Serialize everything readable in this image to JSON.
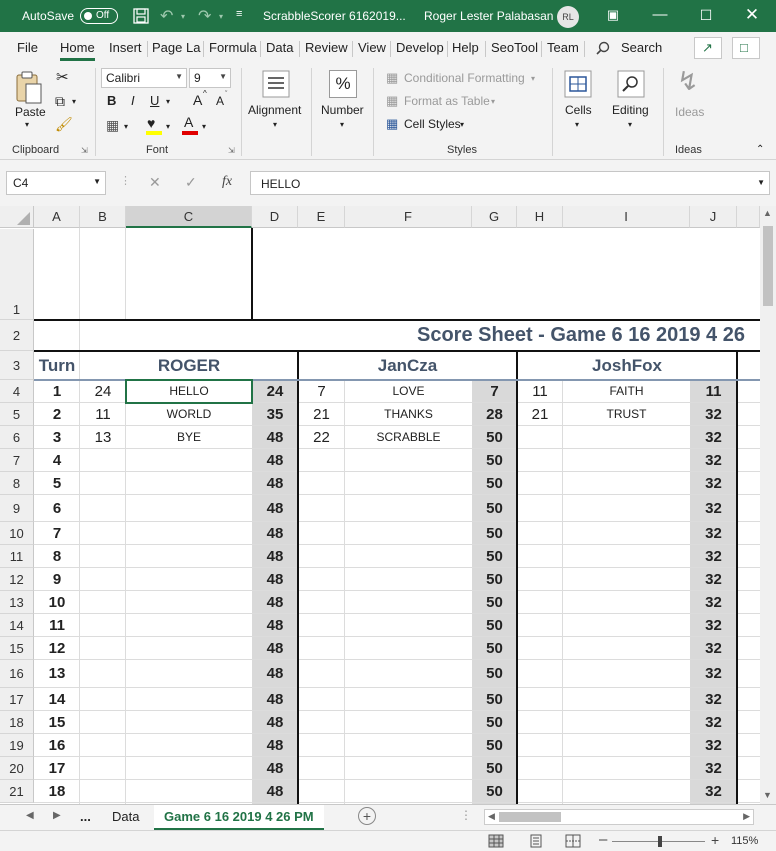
{
  "titlebar": {
    "autosave_label": "AutoSave",
    "autosave_state": "Off",
    "filename": "ScrabbleScorer 6162019...",
    "user_name": "Roger Lester Palabasan",
    "user_initials": "RL"
  },
  "menu": {
    "tabs": [
      "File",
      "Home",
      "Insert",
      "Page La",
      "Formula",
      "Data",
      "Review",
      "View",
      "Develop",
      "Help",
      "SeoTool",
      "Team"
    ],
    "search_label": "Search"
  },
  "ribbon": {
    "clipboard": {
      "paste": "Paste",
      "label": "Clipboard"
    },
    "font": {
      "name": "Calibri",
      "size": "9",
      "label": "Font",
      "bold": "B",
      "italic": "I",
      "underline": "U",
      "grow": "A",
      "shrink": "A"
    },
    "alignment": {
      "label": "Alignment"
    },
    "number": {
      "label": "Number",
      "icon_text": "%"
    },
    "styles": {
      "conditional_formatting": "Conditional Formatting",
      "format_as_table": "Format as Table",
      "cell_styles": "Cell Styles",
      "label": "Styles"
    },
    "cells": {
      "label": "Cells"
    },
    "editing": {
      "label": "Editing"
    },
    "ideas": {
      "label": "Ideas",
      "group_label": "Ideas"
    }
  },
  "formula_bar": {
    "name_box": "C4",
    "fx": "fx",
    "value": "HELLO"
  },
  "sheet": {
    "columns": [
      "A",
      "B",
      "C",
      "D",
      "E",
      "F",
      "G",
      "H",
      "I",
      "J"
    ],
    "title": "Score Sheet  - Game 6 16 2019 4 26",
    "turn_header": "Turn",
    "players": [
      "ROGER",
      "JanCza",
      "JoshFox"
    ],
    "rows": [
      {
        "row": "4",
        "turn": "1",
        "p1_pts": "24",
        "p1_word": "HELLO",
        "p1_total": "24",
        "p2_pts": "7",
        "p2_word": "LOVE",
        "p2_total": "7",
        "p3_pts": "11",
        "p3_word": "FAITH",
        "p3_total": "11"
      },
      {
        "row": "5",
        "turn": "2",
        "p1_pts": "11",
        "p1_word": "WORLD",
        "p1_total": "35",
        "p2_pts": "21",
        "p2_word": "THANKS",
        "p2_total": "28",
        "p3_pts": "21",
        "p3_word": "TRUST",
        "p3_total": "32"
      },
      {
        "row": "6",
        "turn": "3",
        "p1_pts": "13",
        "p1_word": "BYE",
        "p1_total": "48",
        "p2_pts": "22",
        "p2_word": "SCRABBLE",
        "p2_total": "50",
        "p3_pts": "",
        "p3_word": "",
        "p3_total": "32"
      },
      {
        "row": "7",
        "turn": "4",
        "p1_pts": "",
        "p1_word": "",
        "p1_total": "48",
        "p2_pts": "",
        "p2_word": "",
        "p2_total": "50",
        "p3_pts": "",
        "p3_word": "",
        "p3_total": "32"
      },
      {
        "row": "8",
        "turn": "5",
        "p1_pts": "",
        "p1_word": "",
        "p1_total": "48",
        "p2_pts": "",
        "p2_word": "",
        "p2_total": "50",
        "p3_pts": "",
        "p3_word": "",
        "p3_total": "32"
      },
      {
        "row": "9",
        "turn": "6",
        "p1_pts": "",
        "p1_word": "",
        "p1_total": "48",
        "p2_pts": "",
        "p2_word": "",
        "p2_total": "50",
        "p3_pts": "",
        "p3_word": "",
        "p3_total": "32"
      },
      {
        "row": "10",
        "turn": "7",
        "p1_pts": "",
        "p1_word": "",
        "p1_total": "48",
        "p2_pts": "",
        "p2_word": "",
        "p2_total": "50",
        "p3_pts": "",
        "p3_word": "",
        "p3_total": "32"
      },
      {
        "row": "11",
        "turn": "8",
        "p1_pts": "",
        "p1_word": "",
        "p1_total": "48",
        "p2_pts": "",
        "p2_word": "",
        "p2_total": "50",
        "p3_pts": "",
        "p3_word": "",
        "p3_total": "32"
      },
      {
        "row": "12",
        "turn": "9",
        "p1_pts": "",
        "p1_word": "",
        "p1_total": "48",
        "p2_pts": "",
        "p2_word": "",
        "p2_total": "50",
        "p3_pts": "",
        "p3_word": "",
        "p3_total": "32"
      },
      {
        "row": "13",
        "turn": "10",
        "p1_pts": "",
        "p1_word": "",
        "p1_total": "48",
        "p2_pts": "",
        "p2_word": "",
        "p2_total": "50",
        "p3_pts": "",
        "p3_word": "",
        "p3_total": "32"
      },
      {
        "row": "14",
        "turn": "11",
        "p1_pts": "",
        "p1_word": "",
        "p1_total": "48",
        "p2_pts": "",
        "p2_word": "",
        "p2_total": "50",
        "p3_pts": "",
        "p3_word": "",
        "p3_total": "32"
      },
      {
        "row": "15",
        "turn": "12",
        "p1_pts": "",
        "p1_word": "",
        "p1_total": "48",
        "p2_pts": "",
        "p2_word": "",
        "p2_total": "50",
        "p3_pts": "",
        "p3_word": "",
        "p3_total": "32"
      },
      {
        "row": "16",
        "turn": "13",
        "p1_pts": "",
        "p1_word": "",
        "p1_total": "48",
        "p2_pts": "",
        "p2_word": "",
        "p2_total": "50",
        "p3_pts": "",
        "p3_word": "",
        "p3_total": "32"
      },
      {
        "row": "17",
        "turn": "14",
        "p1_pts": "",
        "p1_word": "",
        "p1_total": "48",
        "p2_pts": "",
        "p2_word": "",
        "p2_total": "50",
        "p3_pts": "",
        "p3_word": "",
        "p3_total": "32"
      },
      {
        "row": "18",
        "turn": "15",
        "p1_pts": "",
        "p1_word": "",
        "p1_total": "48",
        "p2_pts": "",
        "p2_word": "",
        "p2_total": "50",
        "p3_pts": "",
        "p3_word": "",
        "p3_total": "32"
      },
      {
        "row": "19",
        "turn": "16",
        "p1_pts": "",
        "p1_word": "",
        "p1_total": "48",
        "p2_pts": "",
        "p2_word": "",
        "p2_total": "50",
        "p3_pts": "",
        "p3_word": "",
        "p3_total": "32"
      },
      {
        "row": "20",
        "turn": "17",
        "p1_pts": "",
        "p1_word": "",
        "p1_total": "48",
        "p2_pts": "",
        "p2_word": "",
        "p2_total": "50",
        "p3_pts": "",
        "p3_word": "",
        "p3_total": "32"
      },
      {
        "row": "21",
        "turn": "18",
        "p1_pts": "",
        "p1_word": "",
        "p1_total": "48",
        "p2_pts": "",
        "p2_word": "",
        "p2_total": "50",
        "p3_pts": "",
        "p3_word": "",
        "p3_total": "32"
      }
    ]
  },
  "sheet_tabs": {
    "ellipsis": "...",
    "tabs": [
      "Data",
      "Game 6 16 2019 4 26 PM"
    ],
    "active_index": 1
  },
  "status": {
    "zoom": "115%"
  },
  "colors": {
    "brand": "#217346",
    "header_text": "#44546a",
    "total_fill": "#d9d9d9"
  }
}
